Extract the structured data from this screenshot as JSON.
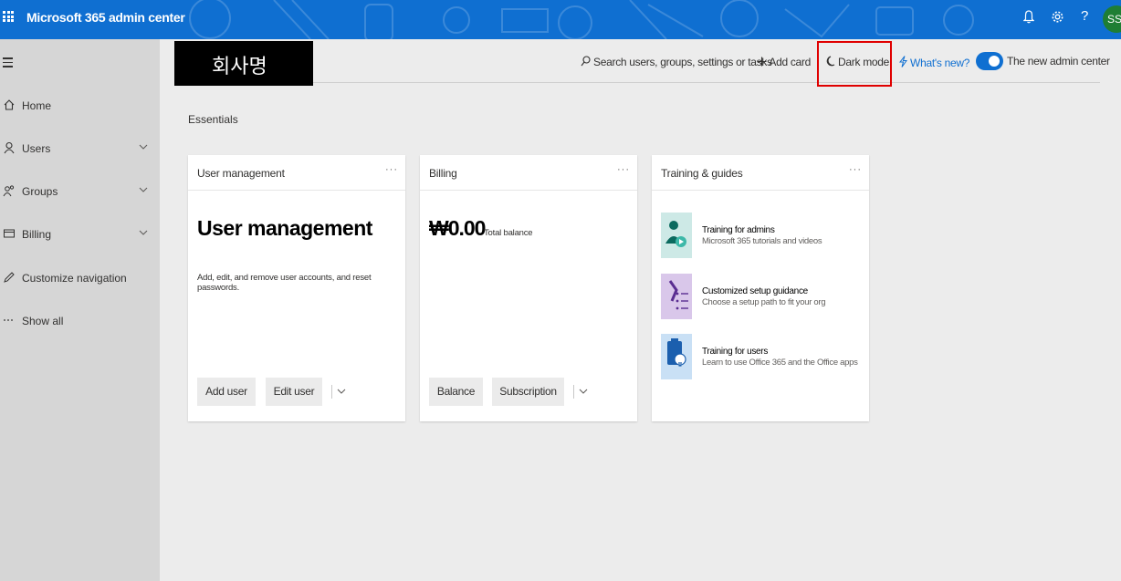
{
  "app": {
    "title": "Microsoft 365 admin center",
    "header_icons": [
      "bell-icon",
      "gear-icon",
      "help-icon"
    ],
    "help_glyph": "?",
    "avatar_initials": "SS",
    "brand_color": "#0f6fd1"
  },
  "leftnav": {
    "items": [
      {
        "label": "Home",
        "icon": "home-icon",
        "has_chevron": false
      },
      {
        "label": "Users",
        "icon": "user-icon",
        "has_chevron": true
      },
      {
        "label": "Groups",
        "icon": "groups-icon",
        "has_chevron": true
      },
      {
        "label": "Billing",
        "icon": "billing-icon",
        "has_chevron": true
      },
      {
        "label": "Customize navigation",
        "icon": "pencil-icon",
        "has_chevron": false
      },
      {
        "label": "Show all",
        "icon": "ellipsis-icon",
        "has_chevron": false
      }
    ]
  },
  "company_name": "회사명",
  "commandbar": {
    "search": "Search users, groups, settings or tasks",
    "add_card": "Add card",
    "dark_mode": "Dark mode",
    "whats_new": "What's new?",
    "new_admin_center": "The new admin center",
    "new_admin_center_on": true,
    "highlight_color": "#e00000"
  },
  "essentials_label": "Essentials",
  "cards": {
    "user_management": {
      "title": "User management",
      "heading": "User management",
      "description": "Add, edit, and remove user accounts, and reset passwords.",
      "buttons": [
        "Add user",
        "Edit user"
      ]
    },
    "billing": {
      "title": "Billing",
      "amount": "₩0.00",
      "amount_label": "Total balance",
      "buttons": [
        "Balance",
        "Subscription"
      ]
    },
    "training": {
      "title": "Training & guides",
      "items": [
        {
          "title": "Training for admins",
          "subtitle": "Microsoft 365 tutorials and videos",
          "icon": "admin-training-icon",
          "color": "#cde9e6"
        },
        {
          "title": "Customized setup guidance",
          "subtitle": "Choose a setup path to fit your org",
          "icon": "setup-guidance-icon",
          "color": "#d9c7ea"
        },
        {
          "title": "Training for users",
          "subtitle": "Learn to use Office 365 and the Office apps",
          "icon": "user-training-icon",
          "color": "#c9e0f5"
        }
      ]
    },
    "more_glyph": "···"
  }
}
